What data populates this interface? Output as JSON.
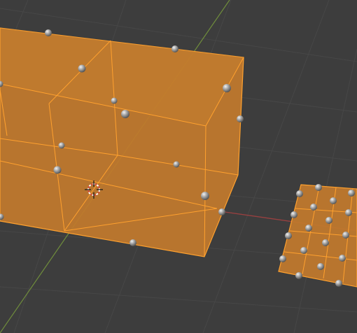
{
  "editor": {
    "type": "3D Viewport",
    "mode": "Edit Mode",
    "background_color": "#3d3d3d",
    "grid_color": "#474747",
    "x_axis_color": "#9a4040",
    "y_axis_color": "#6f8d3c"
  },
  "selection": {
    "face_fill_color": "#c27a2c",
    "edge_color": "#ffa12e",
    "control_point_color": "#a8a8a8"
  },
  "objects": [
    {
      "name": "cube-mesh",
      "kind": "subdivided box"
    },
    {
      "name": "plane-mesh",
      "kind": "subdivided plane"
    }
  ],
  "icons": {
    "cursor": "3d-cursor-icon",
    "point": "control-point-icon"
  }
}
